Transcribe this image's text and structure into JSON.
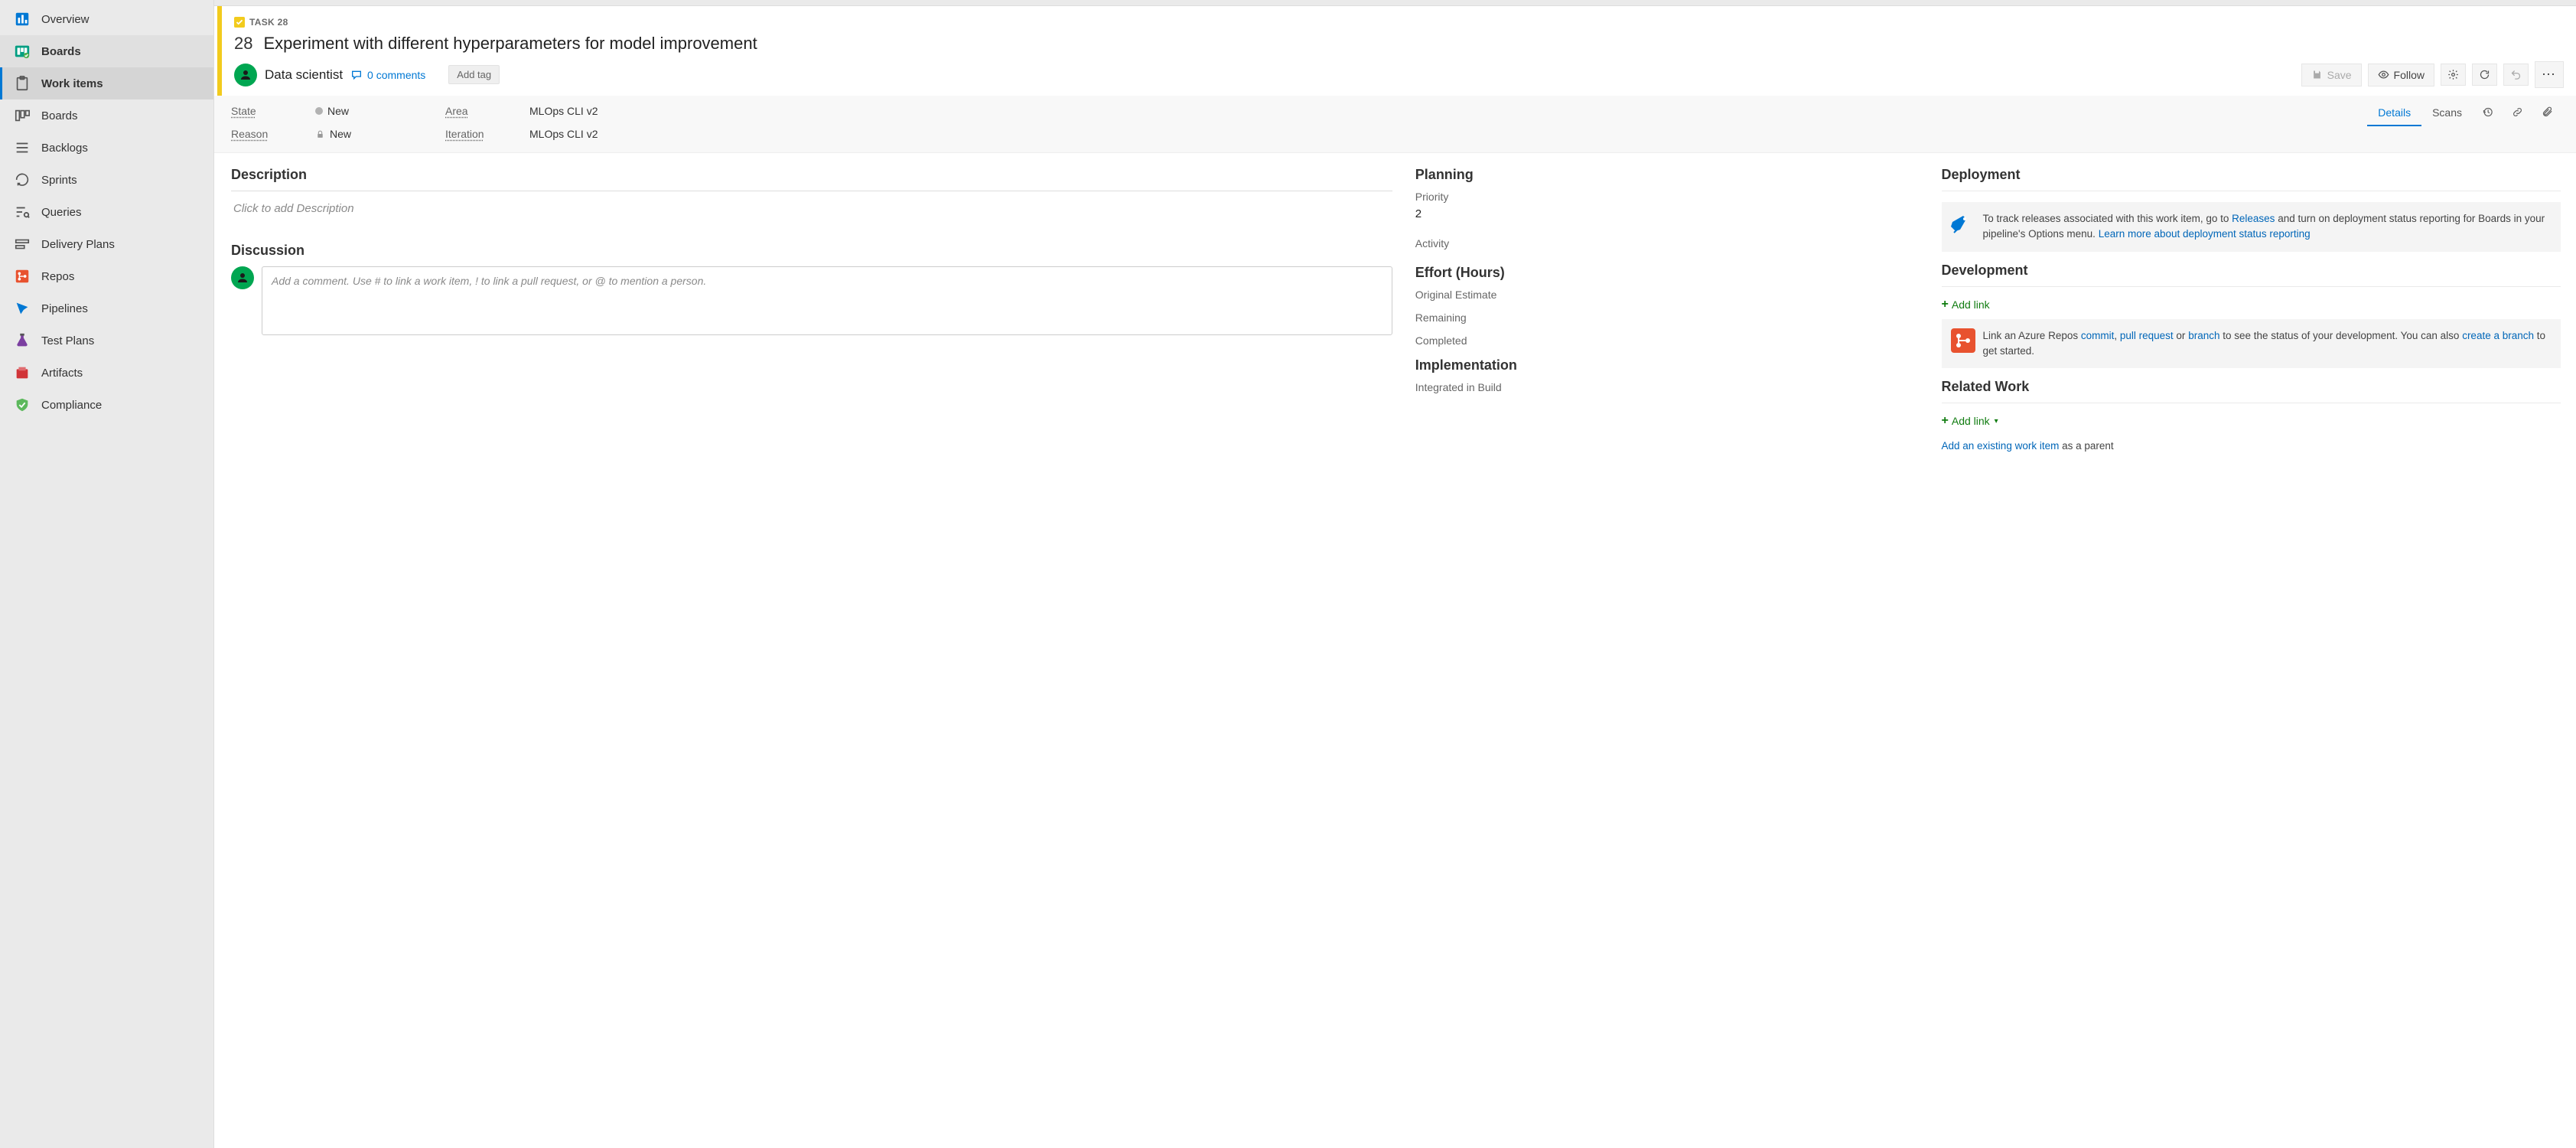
{
  "sidebar": {
    "items": [
      {
        "label": "Overview"
      },
      {
        "label": "Boards"
      },
      {
        "label": "Work items"
      },
      {
        "label": "Boards"
      },
      {
        "label": "Backlogs"
      },
      {
        "label": "Sprints"
      },
      {
        "label": "Queries"
      },
      {
        "label": "Delivery Plans"
      },
      {
        "label": "Repos"
      },
      {
        "label": "Pipelines"
      },
      {
        "label": "Test Plans"
      },
      {
        "label": "Artifacts"
      },
      {
        "label": "Compliance"
      }
    ]
  },
  "workItem": {
    "type": "TASK",
    "id": "28",
    "badge": "TASK 28",
    "title": "Experiment with different hyperparameters for model improvement",
    "assignee": "Data scientist",
    "commentsLabel": "0 comments",
    "addTag": "Add tag",
    "save": "Save",
    "follow": "Follow",
    "state_label": "State",
    "state_value": "New",
    "reason_label": "Reason",
    "reason_value": "New",
    "area_label": "Area",
    "area_value": "MLOps CLI v2",
    "iteration_label": "Iteration",
    "iteration_value": "MLOps CLI v2"
  },
  "tabs": {
    "details": "Details",
    "scans": "Scans"
  },
  "sections": {
    "description_title": "Description",
    "description_placeholder": "Click to add Description",
    "discussion_title": "Discussion",
    "discussion_placeholder": "Add a comment. Use # to link a work item, ! to link a pull request, or @ to mention a person.",
    "planning_title": "Planning",
    "priority_label": "Priority",
    "priority_value": "2",
    "activity_label": "Activity",
    "effort_title": "Effort (Hours)",
    "original_estimate": "Original Estimate",
    "remaining": "Remaining",
    "completed": "Completed",
    "implementation_title": "Implementation",
    "integrated_label": "Integrated in Build",
    "deployment_title": "Deployment",
    "deployment_text1": "To track releases associated with this work item, go to ",
    "deployment_link1": "Releases",
    "deployment_text2": " and turn on deployment status reporting for Boards in your pipeline's Options menu. ",
    "deployment_link2": "Learn more about deployment status reporting",
    "development_title": "Development",
    "add_link": "Add link",
    "dev_text1": "Link an Azure Repos ",
    "dev_commit": "commit",
    "dev_comma": ", ",
    "dev_pr": "pull request",
    "dev_or": " or ",
    "dev_branch": "branch",
    "dev_text2": " to see the status of your development. You can also ",
    "dev_create": "create a branch",
    "dev_text3": " to get started.",
    "related_title": "Related Work",
    "existing_link": "Add an existing work item",
    "existing_suffix": " as a parent"
  }
}
